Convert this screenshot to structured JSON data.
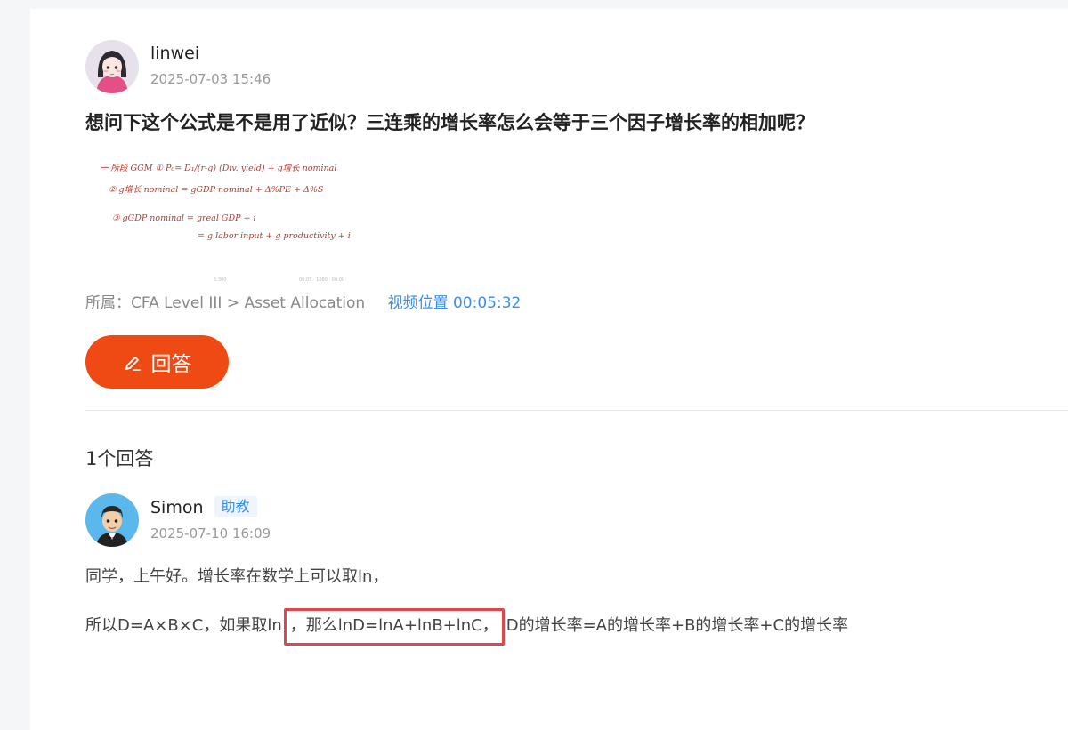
{
  "question": {
    "author": "linwei",
    "time": "2025-07-03 15:46",
    "title": "想问下这个公式是不是用了近似？三连乘的增长率怎么会等于三个因子增长率的相加呢？",
    "category_label": "所属：",
    "category_path": "CFA Level III > Asset Allocation",
    "video_label": "视频位置",
    "video_time": "00:05:32"
  },
  "handwriting": {
    "line1": "一 所段 GGM ① P₀= D₁/(r-g) (Div. yield) + g增长 nominal",
    "line2": "② g增长 nominal = gGDP nominal + Δ%PE + Δ%S",
    "line3": "③ gGDP nominal = greal GDP + i",
    "line4": "= g labor input + g productivity + i",
    "foot_left": "5:300",
    "foot_right": "00:05 · 1080 · 00:00"
  },
  "answer_button": {
    "label": "回答",
    "icon": "pen-icon"
  },
  "answers": {
    "count_label": "1个回答",
    "items": [
      {
        "author": "Simon",
        "role": "助教",
        "time": "2025-07-10 16:09",
        "para1": "同学，上午好。增长率在数学上可以取ln，",
        "para2_before": "所以D=A×B×C，如果取ln",
        "para2_highlight": "，那么lnD=lnA+lnB+lnC，",
        "para2_after": "D的增长率=A的增长率+B的增长率+C的增长率"
      }
    ]
  },
  "colors": {
    "accent": "#f04a14",
    "link": "#3a8ee6",
    "highlight_border": "#e0464d",
    "handwriting": "#b83a2e"
  }
}
